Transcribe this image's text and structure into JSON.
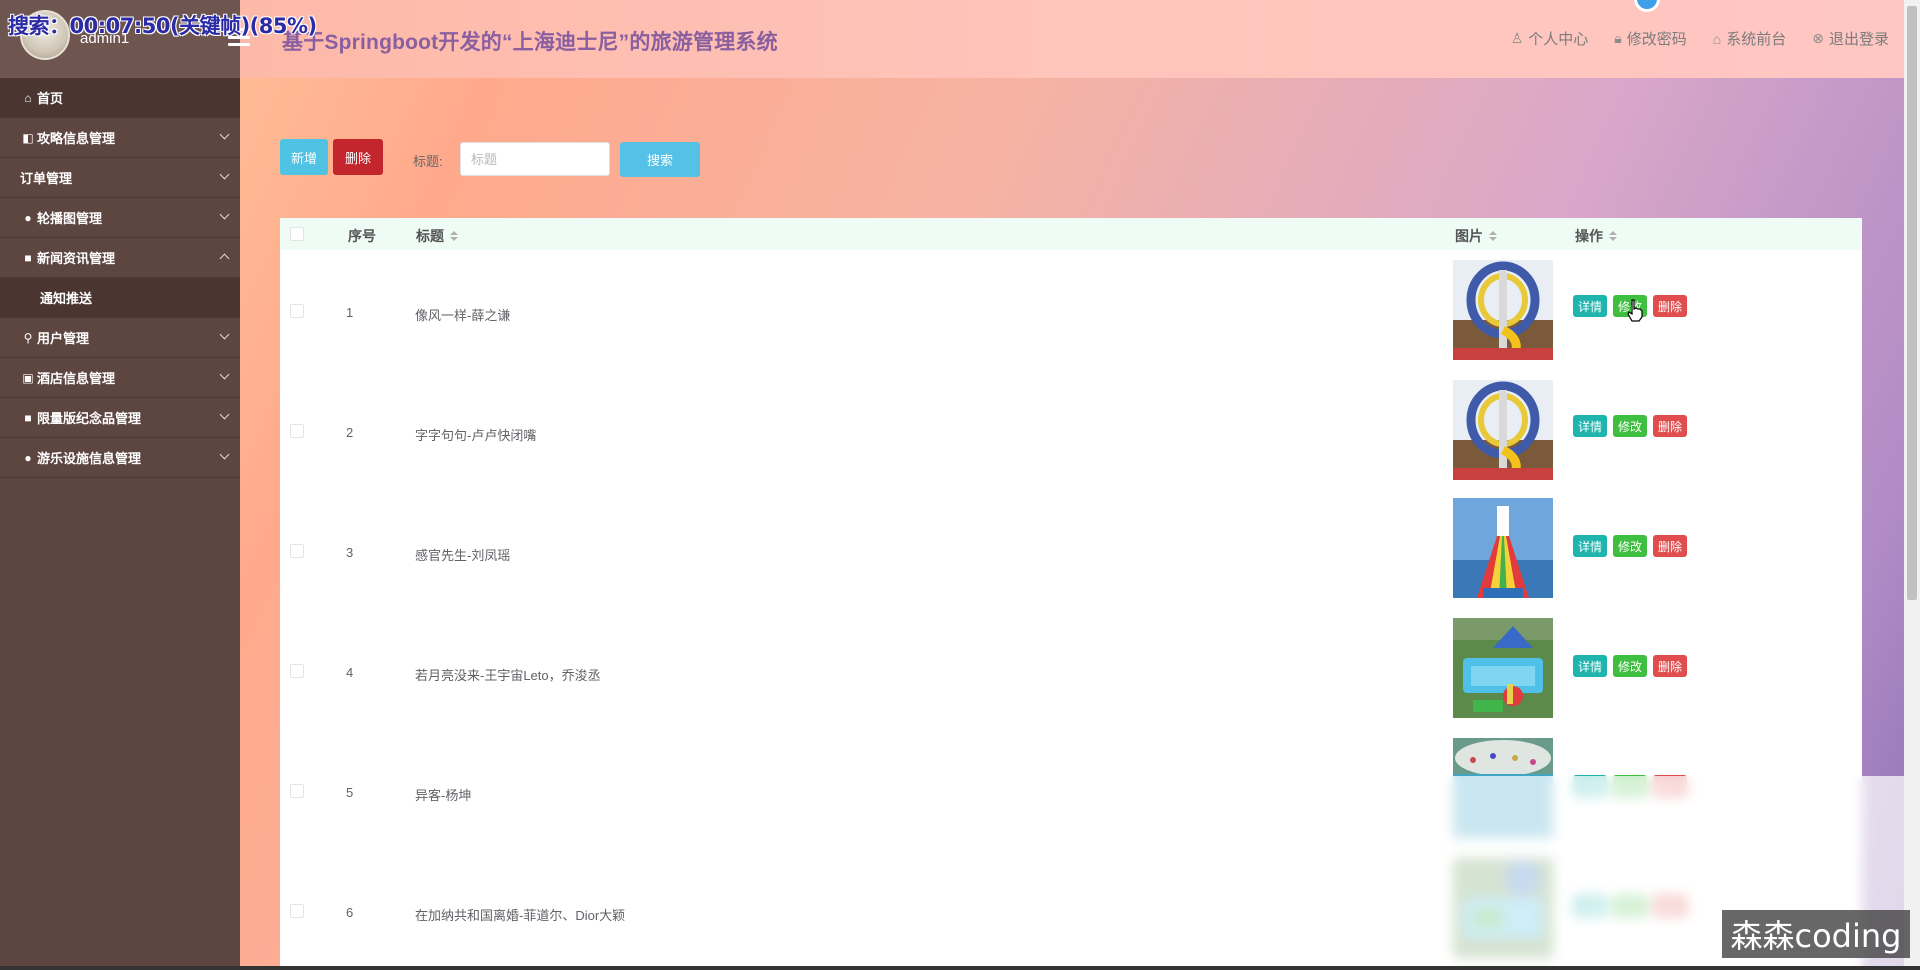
{
  "osd": {
    "text": "搜索：00:07:50(关键帧)(85%)"
  },
  "user": {
    "name": "admin1"
  },
  "header": {
    "title": "基于Springboot开发的“上海迪士尼”的旅游管理系统",
    "nav": [
      {
        "icon": "user-icon",
        "label": "个人中心"
      },
      {
        "icon": "lock-icon",
        "label": "修改密码"
      },
      {
        "icon": "home-icon",
        "label": "系统前台"
      },
      {
        "icon": "logout-icon",
        "label": "退出登录"
      }
    ]
  },
  "sidebar": {
    "items": [
      {
        "icon": "home-icon",
        "label": "首页"
      },
      {
        "icon": "card-icon",
        "label": "攻略信息管理"
      },
      {
        "icon": "",
        "label": "订单管理"
      },
      {
        "icon": "dot-icon",
        "label": "轮播图管理"
      },
      {
        "icon": "square-icon",
        "label": "新闻资讯管理",
        "expanded": true,
        "children": [
          "通知推送"
        ]
      },
      {
        "icon": "user-icon",
        "label": "用户管理"
      },
      {
        "icon": "picture-icon",
        "label": "酒店信息管理"
      },
      {
        "icon": "square-icon",
        "label": "限量版纪念品管理"
      },
      {
        "icon": "dot-icon",
        "label": "游乐设施信息管理"
      }
    ]
  },
  "toolbar": {
    "add_label": "新增",
    "delete_label": "删除",
    "search_label": "标题:",
    "search_placeholder": "标题",
    "search_button": "搜索"
  },
  "table": {
    "columns": {
      "index": "序号",
      "title": "标题",
      "image": "图片",
      "actions": "操作"
    },
    "action_labels": {
      "detail": "详情",
      "edit": "修改",
      "delete": "删除"
    },
    "rows": [
      {
        "index": "1",
        "title": "像风一样-薛之谦",
        "image": "water-slide-tower"
      },
      {
        "index": "2",
        "title": "字字句句-卢卢快闭嘴",
        "image": "water-slide-tower"
      },
      {
        "index": "3",
        "title": "感官先生-刘凤瑶",
        "image": "rainbow-slide"
      },
      {
        "index": "4",
        "title": "若月亮没来-王宇宙Leto，乔浚丞",
        "image": "water-park-pool"
      },
      {
        "index": "5",
        "title": "异客-杨坤",
        "image": "wave-pool"
      },
      {
        "index": "6",
        "title": "在加纳共和国离婚-菲道尔、Dior大颖",
        "image": "water-park-pool"
      }
    ]
  },
  "watermark": {
    "text": "森森coding"
  }
}
